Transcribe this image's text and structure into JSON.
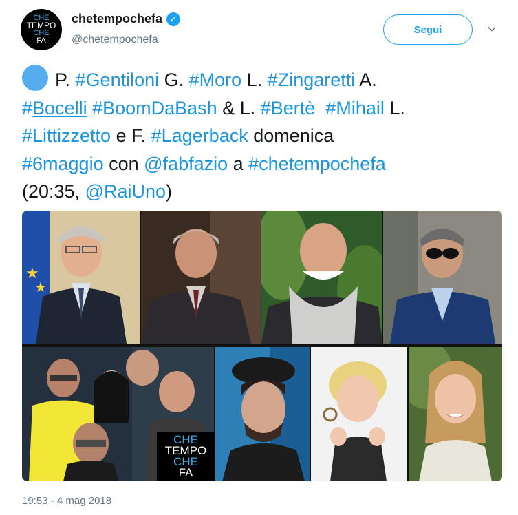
{
  "account": {
    "display_name": "chetempochefa",
    "handle": "@chetempochefa",
    "verified_icon": "verified-badge-icon",
    "avatar_words": [
      "CHE",
      "TEMPO",
      "CHE",
      "FA"
    ]
  },
  "header": {
    "follow_label": "Segui",
    "more_icon": "chevron-down-icon"
  },
  "tweet": {
    "emoji": "blue-circle",
    "lines": [
      [
        {
          "t": "P. ",
          "k": "text"
        },
        {
          "t": "#Gentiloni",
          "k": "hashtag"
        },
        {
          "t": " G. ",
          "k": "text"
        },
        {
          "t": "#Moro",
          "k": "hashtag"
        },
        {
          "t": " L. ",
          "k": "text"
        },
        {
          "t": "#Zingaretti",
          "k": "hashtag"
        },
        {
          "t": " A.",
          "k": "text"
        }
      ],
      [
        {
          "t": "#",
          "k": "hashtag"
        },
        {
          "t": "Bocelli",
          "k": "hashtag-underlined"
        },
        {
          "t": " ",
          "k": "text"
        },
        {
          "t": "#BoomDaBash",
          "k": "hashtag"
        },
        {
          "t": " & L. ",
          "k": "text"
        },
        {
          "t": "#Bertè",
          "k": "hashtag"
        },
        {
          "t": "  ",
          "k": "text"
        },
        {
          "t": "#Mihail",
          "k": "hashtag"
        },
        {
          "t": " L.",
          "k": "text"
        }
      ],
      [
        {
          "t": "#Littizzetto",
          "k": "hashtag"
        },
        {
          "t": " e F. ",
          "k": "text"
        },
        {
          "t": "#Lagerback",
          "k": "hashtag"
        },
        {
          "t": " domenica",
          "k": "text"
        }
      ],
      [
        {
          "t": "#6maggio",
          "k": "hashtag"
        },
        {
          "t": " con ",
          "k": "text"
        },
        {
          "t": "@fabfazio",
          "k": "mention"
        },
        {
          "t": " a ",
          "k": "text"
        },
        {
          "t": "#chetempochefa",
          "k": "hashtag"
        }
      ],
      [
        {
          "t": "(20:35, ",
          "k": "text"
        },
        {
          "t": "@RaiUno",
          "k": "mention"
        },
        {
          "t": ")",
          "k": "text"
        }
      ]
    ]
  },
  "media": {
    "logo_words": [
      "CHE",
      "TEMPO",
      "CHE",
      "FA"
    ],
    "photos": [
      "photo-gentiloni",
      "photo-moro",
      "photo-zingaretti",
      "photo-bocelli",
      "photo-boomdabash",
      "photo-mihail",
      "photo-littizzetto",
      "photo-lagerback"
    ]
  },
  "timestamp": "19:53 - 4 mag 2018",
  "colors": {
    "link": "#1b95e0",
    "brand": "#1da1f2",
    "secondary_text": "#657786",
    "primary_text": "#14171a"
  }
}
